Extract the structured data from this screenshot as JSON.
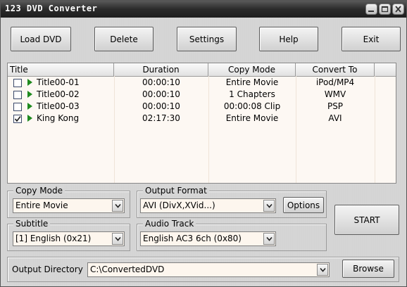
{
  "window": {
    "title": "123 DVD Converter",
    "controls": [
      "minimize-icon",
      "maximize-icon",
      "close-icon"
    ]
  },
  "toolbar": {
    "load_dvd": "Load DVD",
    "delete": "Delete",
    "settings": "Settings",
    "help": "Help",
    "exit": "Exit"
  },
  "table": {
    "columns": [
      "Title",
      "Duration",
      "Copy Mode",
      "Convert To"
    ],
    "rows": [
      {
        "checked": false,
        "title": "Title00-01",
        "duration": "00:00:10",
        "copy_mode": "Entire Movie",
        "convert_to": "iPod/MP4"
      },
      {
        "checked": false,
        "title": "Title00-02",
        "duration": "00:00:10",
        "copy_mode": "1 Chapters",
        "convert_to": "WMV"
      },
      {
        "checked": false,
        "title": "Title00-03",
        "duration": "00:00:10",
        "copy_mode": "00:00:08 Clip",
        "convert_to": "PSP"
      },
      {
        "checked": true,
        "title": "King Kong",
        "duration": "02:17:30",
        "copy_mode": "Entire Movie",
        "convert_to": "AVI"
      }
    ]
  },
  "copy_mode": {
    "label": "Copy Mode",
    "value": "Entire Movie"
  },
  "output_format": {
    "label": "Output Format",
    "value": "AVI (DivX,XVid...)",
    "options_button": "Options"
  },
  "subtitle": {
    "label": "Subtitle",
    "value": "[1] English (0x21)"
  },
  "audio_track": {
    "label": "Audio Track",
    "value": "English AC3 6ch (0x80)"
  },
  "start_button": "START",
  "output_directory": {
    "label": "Output Directory",
    "value": "C:\\ConvertedDVD",
    "browse": "Browse"
  },
  "colors": {
    "titlebar": "#2b2b2b",
    "play": "#1f8a1f",
    "list_bg": "#fdf8f3"
  }
}
